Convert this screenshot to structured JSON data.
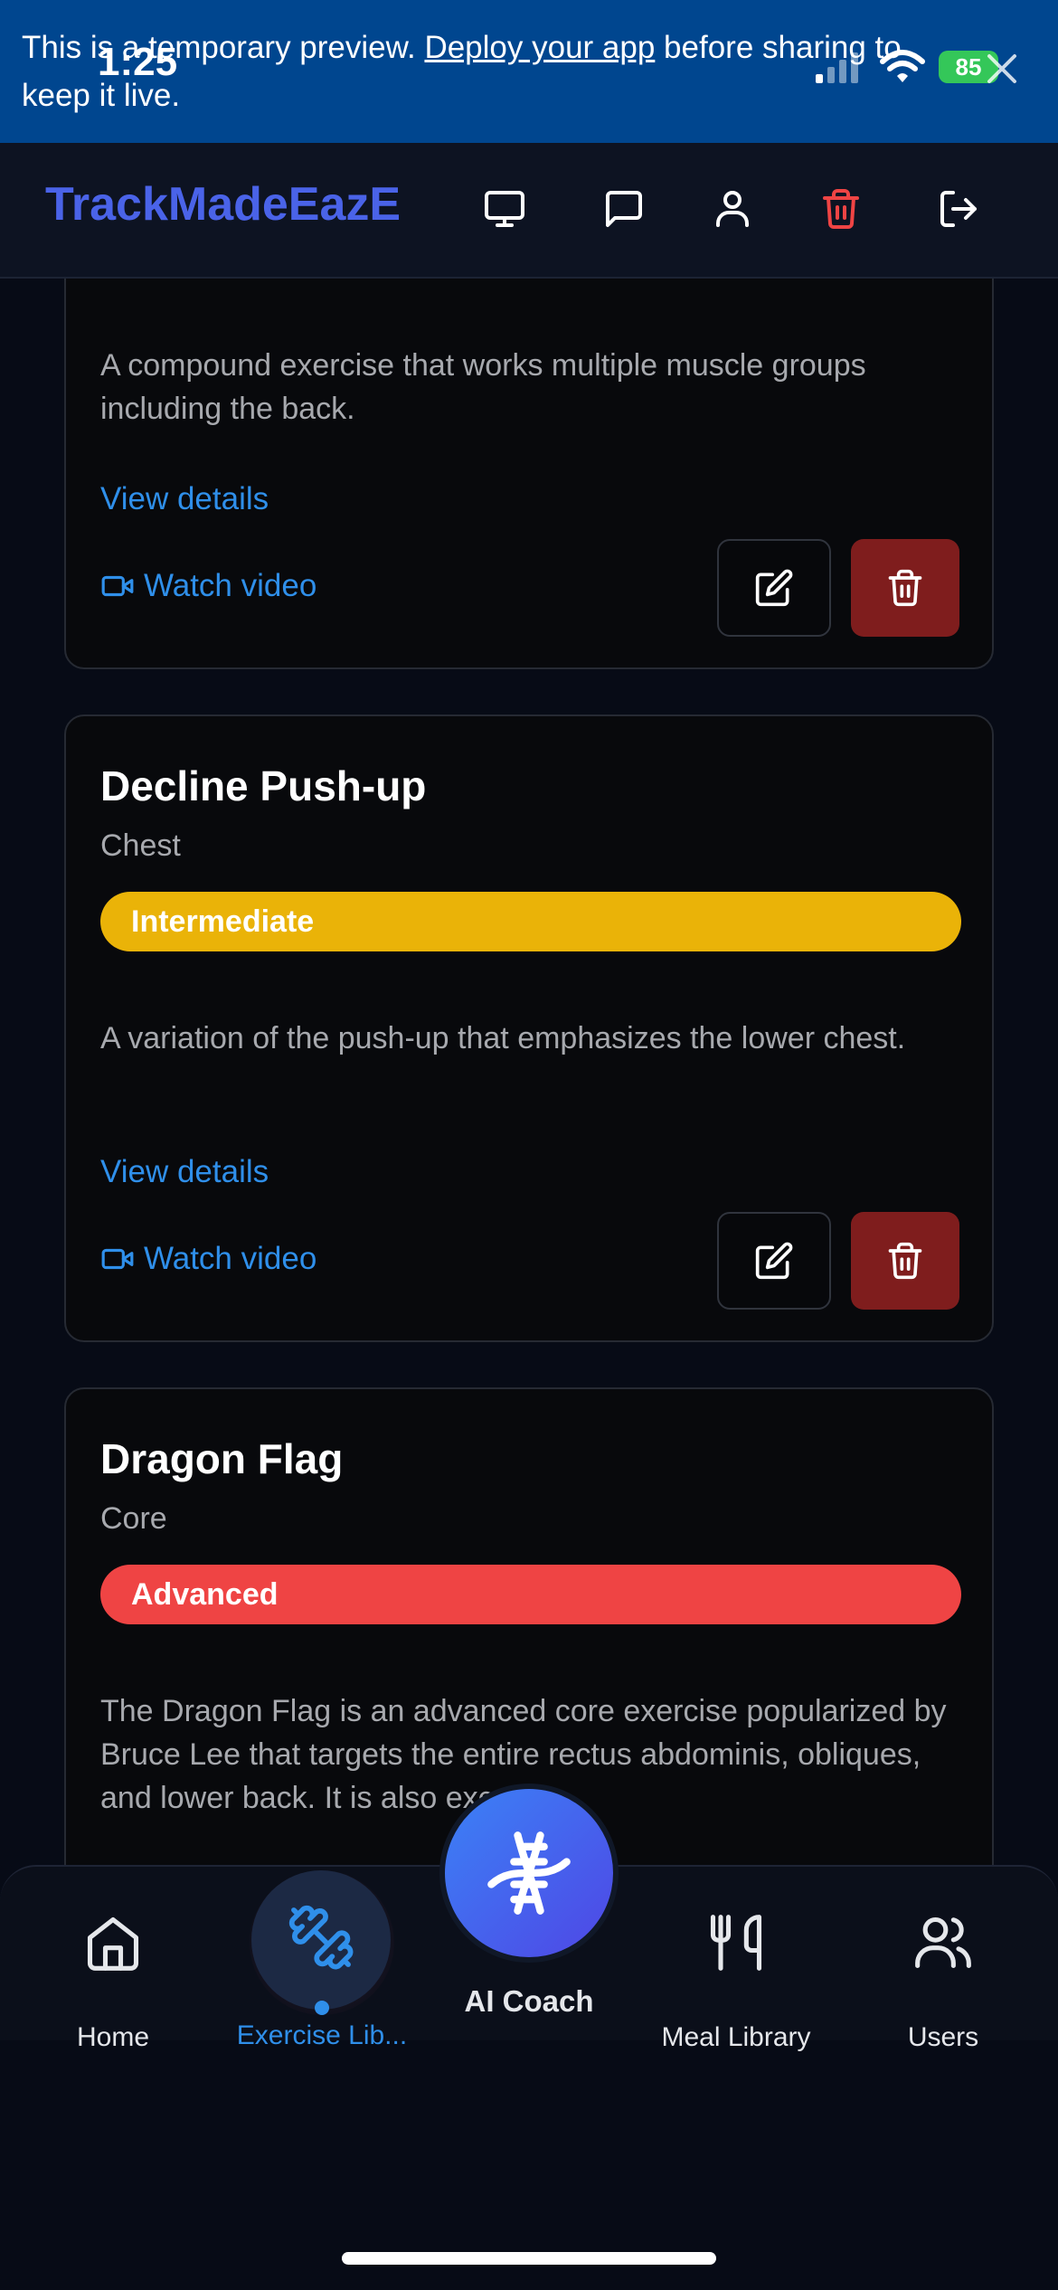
{
  "status": {
    "time": "1:25",
    "battery": "85"
  },
  "preview": {
    "text_before": "This is a temporary preview. ",
    "link": "Deploy your app",
    "text_after": " before sharing to keep it live."
  },
  "app": {
    "brand": "TrackMadeEazE",
    "header_icons": [
      "monitor-icon",
      "message-icon",
      "user-icon",
      "trash-icon",
      "logout-icon"
    ]
  },
  "exercises": [
    {
      "title": "",
      "category": "",
      "level": "",
      "description": "A compound exercise that works multiple muscle groups including the back.",
      "view_label": "View details",
      "video_label": "Watch video"
    },
    {
      "title": "Decline Push-up",
      "category": "Chest",
      "level": "Intermediate",
      "description": "A variation of the push-up that emphasizes the lower chest.",
      "view_label": "View details",
      "video_label": "Watch video"
    },
    {
      "title": "Dragon Flag",
      "category": "Core",
      "level": "Advanced",
      "description": "The Dragon Flag is an advanced core exercise popularized by Bruce Lee that targets the entire rectus abdominis, obliques, and lower back. It is also excelle...",
      "view_label": "",
      "video_label": ""
    }
  ],
  "nav": {
    "home": "Home",
    "exercise": "Exercise Lib...",
    "ai": "AI Coach",
    "meal": "Meal Library",
    "users": "Users"
  },
  "colors": {
    "brand": "#4a63e8",
    "link": "#2f8fea",
    "intermediate": "#eab308",
    "advanced": "#ef4444",
    "delete": "#7f1d1d"
  }
}
